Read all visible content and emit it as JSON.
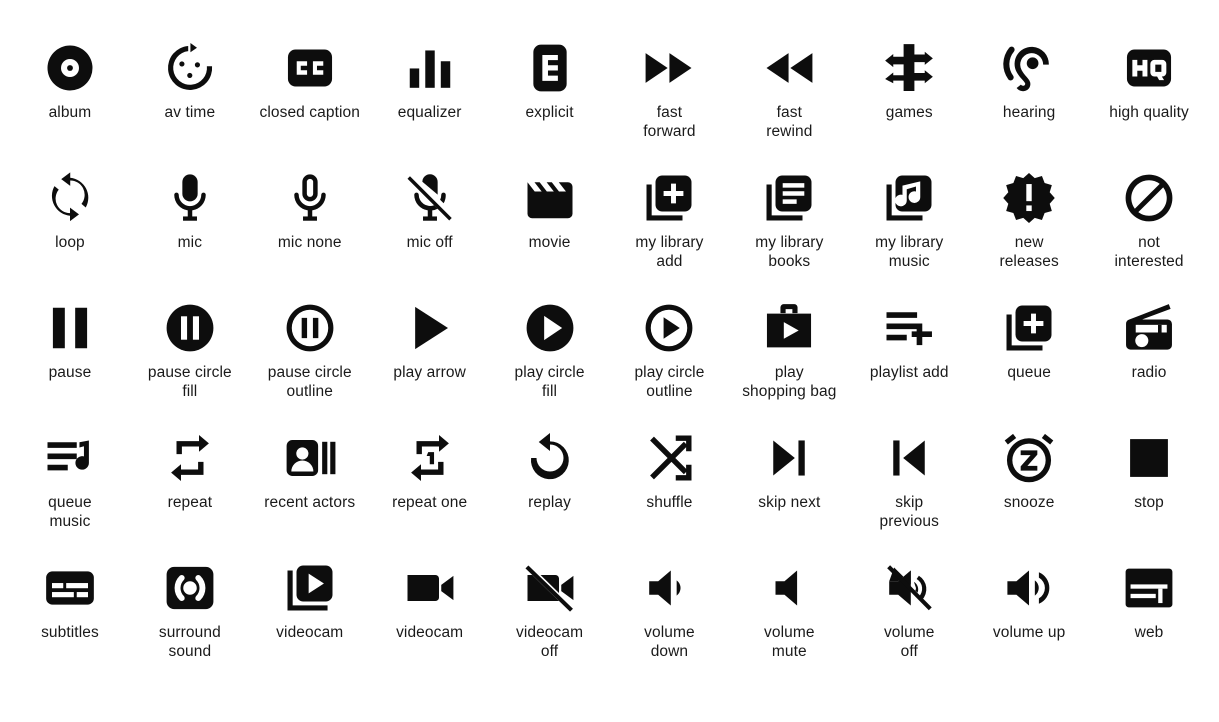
{
  "page": {
    "title": "Media Icons Grid",
    "background_color": "#ffffff",
    "icon_color": "#0d0d0d",
    "label_color": "#1a1a1a",
    "columns": 10,
    "rows": 5
  },
  "icons": [
    {
      "label": "album",
      "icon": "album-icon"
    },
    {
      "label": "av time",
      "icon": "av-time-icon"
    },
    {
      "label": "closed caption",
      "icon": "closed-caption-icon"
    },
    {
      "label": "equalizer",
      "icon": "equalizer-icon"
    },
    {
      "label": "explicit",
      "icon": "explicit-icon"
    },
    {
      "label": "fast\nforward",
      "icon": "fast-forward-icon"
    },
    {
      "label": "fast\nrewind",
      "icon": "fast-rewind-icon"
    },
    {
      "label": "games",
      "icon": "games-icon"
    },
    {
      "label": "hearing",
      "icon": "hearing-icon"
    },
    {
      "label": "high quality",
      "icon": "high-quality-icon"
    },
    {
      "label": "loop",
      "icon": "loop-icon"
    },
    {
      "label": "mic",
      "icon": "mic-icon"
    },
    {
      "label": "mic none",
      "icon": "mic-none-icon"
    },
    {
      "label": "mic off",
      "icon": "mic-off-icon"
    },
    {
      "label": "movie",
      "icon": "movie-icon"
    },
    {
      "label": "my library\nadd",
      "icon": "my-library-add-icon"
    },
    {
      "label": "my library\nbooks",
      "icon": "my-library-books-icon"
    },
    {
      "label": "my library\nmusic",
      "icon": "my-library-music-icon"
    },
    {
      "label": "new\nreleases",
      "icon": "new-releases-icon"
    },
    {
      "label": "not\ninterested",
      "icon": "not-interested-icon"
    },
    {
      "label": "pause",
      "icon": "pause-icon"
    },
    {
      "label": "pause circle\nfill",
      "icon": "pause-circle-fill-icon"
    },
    {
      "label": "pause circle\noutline",
      "icon": "pause-circle-outline-icon"
    },
    {
      "label": "play arrow",
      "icon": "play-arrow-icon"
    },
    {
      "label": "play circle\nfill",
      "icon": "play-circle-fill-icon"
    },
    {
      "label": "play circle\noutline",
      "icon": "play-circle-outline-icon"
    },
    {
      "label": "play\nshopping bag",
      "icon": "play-shopping-bag-icon"
    },
    {
      "label": "playlist add",
      "icon": "playlist-add-icon"
    },
    {
      "label": "queue",
      "icon": "queue-icon"
    },
    {
      "label": "radio",
      "icon": "radio-icon"
    },
    {
      "label": "queue\nmusic",
      "icon": "queue-music-icon"
    },
    {
      "label": "repeat",
      "icon": "repeat-icon"
    },
    {
      "label": "recent actors",
      "icon": "recent-actors-icon"
    },
    {
      "label": "repeat one",
      "icon": "repeat-one-icon"
    },
    {
      "label": "replay",
      "icon": "replay-icon"
    },
    {
      "label": "shuffle",
      "icon": "shuffle-icon"
    },
    {
      "label": "skip next",
      "icon": "skip-next-icon"
    },
    {
      "label": "skip\nprevious",
      "icon": "skip-previous-icon"
    },
    {
      "label": "snooze",
      "icon": "snooze-icon"
    },
    {
      "label": "stop",
      "icon": "stop-icon"
    },
    {
      "label": "subtitles",
      "icon": "subtitles-icon"
    },
    {
      "label": "surround\nsound",
      "icon": "surround-sound-icon"
    },
    {
      "label": "videocam",
      "icon": "videocam-play-icon"
    },
    {
      "label": "videocam",
      "icon": "videocam-icon"
    },
    {
      "label": "videocam\noff",
      "icon": "videocam-off-icon"
    },
    {
      "label": "volume\ndown",
      "icon": "volume-down-icon"
    },
    {
      "label": "volume\nmute",
      "icon": "volume-mute-icon"
    },
    {
      "label": "volume\noff",
      "icon": "volume-off-icon"
    },
    {
      "label": "volume up",
      "icon": "volume-up-icon"
    },
    {
      "label": "web",
      "icon": "web-icon"
    }
  ]
}
